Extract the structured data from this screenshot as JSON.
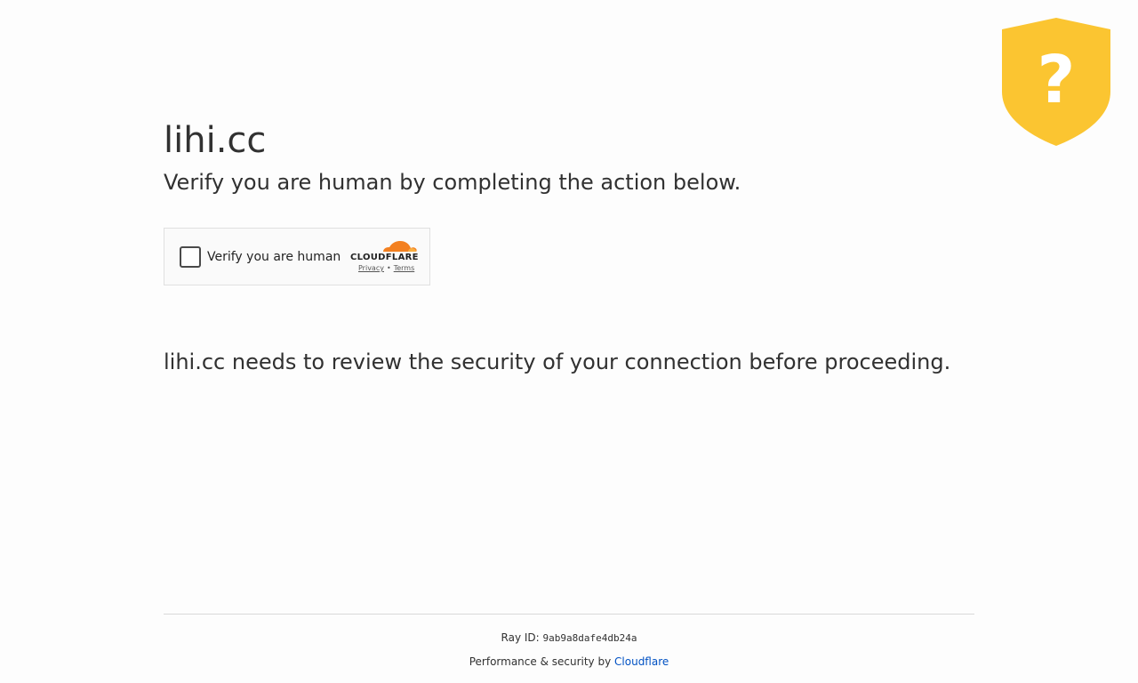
{
  "site": {
    "domain_title": "lihi.cc",
    "subtitle": "Verify you are human by completing the action below.",
    "review_message": "lihi.cc needs to review the security of your connection before proceeding."
  },
  "shield": {
    "icon": "question-shield-icon",
    "color": "#fbc531",
    "glyph": "?"
  },
  "widget": {
    "checkbox_label": "Verify you are human",
    "brand": "CLOUDFLARE",
    "privacy_link": "Privacy",
    "separator": "•",
    "terms_link": "Terms",
    "cloud_colors": [
      "#f38020",
      "#faae40"
    ]
  },
  "footer": {
    "ray_label": "Ray ID:",
    "ray_id": "9ab9a8dafe4db24a",
    "perf_text": "Performance & security by",
    "perf_link": "Cloudflare",
    "link_color": "#0051c3"
  }
}
